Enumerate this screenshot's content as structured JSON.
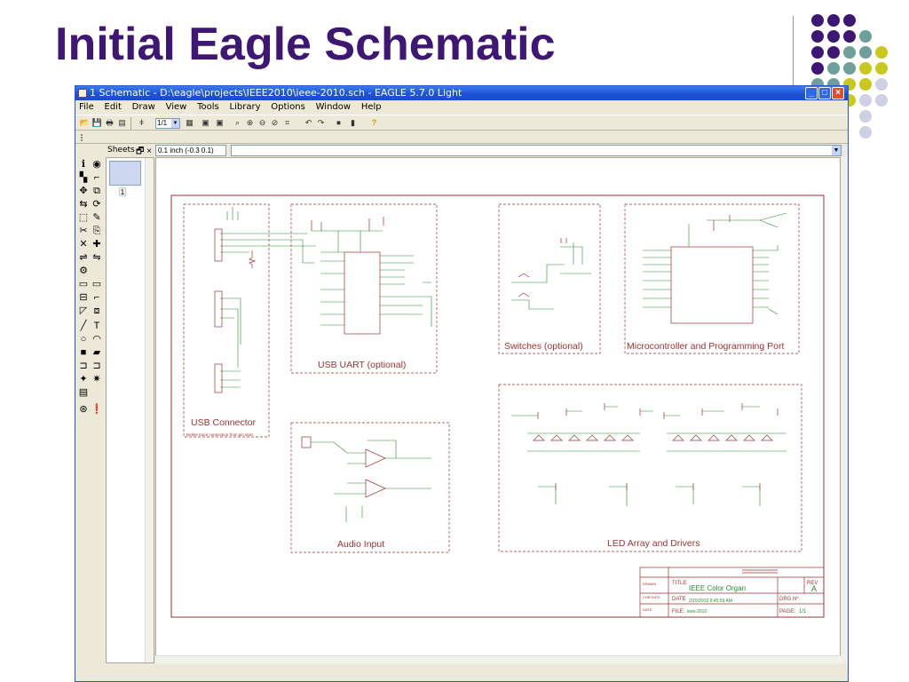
{
  "slide": {
    "title": "Initial Eagle Schematic"
  },
  "window": {
    "title": "1 Schematic - D:\\eagle\\projects\\IEEE2010\\ieee-2010.sch - EAGLE 5.7.0 Light",
    "menu": [
      "File",
      "Edit",
      "Draw",
      "View",
      "Tools",
      "Library",
      "Options",
      "Window",
      "Help"
    ],
    "zoom_value": "1/1",
    "sheets_label": "Sheets",
    "coord_readout": "0.1 inch (-0.3 0.1)",
    "sheet_number": "1"
  },
  "schematic": {
    "blocks": {
      "usb_connector": "USB Connector",
      "usb_note": "Delete trace connection from pin start",
      "usb_uart": "USB UART (optional)",
      "switches": "Switches (optional)",
      "micro": "Microcontroller and Programming Port",
      "audio": "Audio Input",
      "led": "LED Array and Drivers"
    },
    "titleblock": {
      "title_label": "TITLE",
      "title_value": "IEEE Color Organ",
      "rev_label": "REV",
      "rev_value": "A",
      "date_label": "DATE",
      "date_value": "2/15/2010 9:45:59 AM",
      "dwg_label": "DRG Nº",
      "file_label": "FILE:",
      "file_value": "ieee-2010",
      "page_label": "PAGE:",
      "page_value": "1/1",
      "drawn": "DRAWN",
      "checked": "CHECKED",
      "date_row": "DATE"
    }
  },
  "colors": {
    "title_purple": "#3d1773",
    "schematic_frame": "#9b3232",
    "net_green": "#2c8a2c",
    "dot_purple": "#3d1773",
    "dot_teal": "#6e9f9a",
    "dot_olive": "#c8c81e",
    "dot_lavender": "#cfcfe6"
  }
}
